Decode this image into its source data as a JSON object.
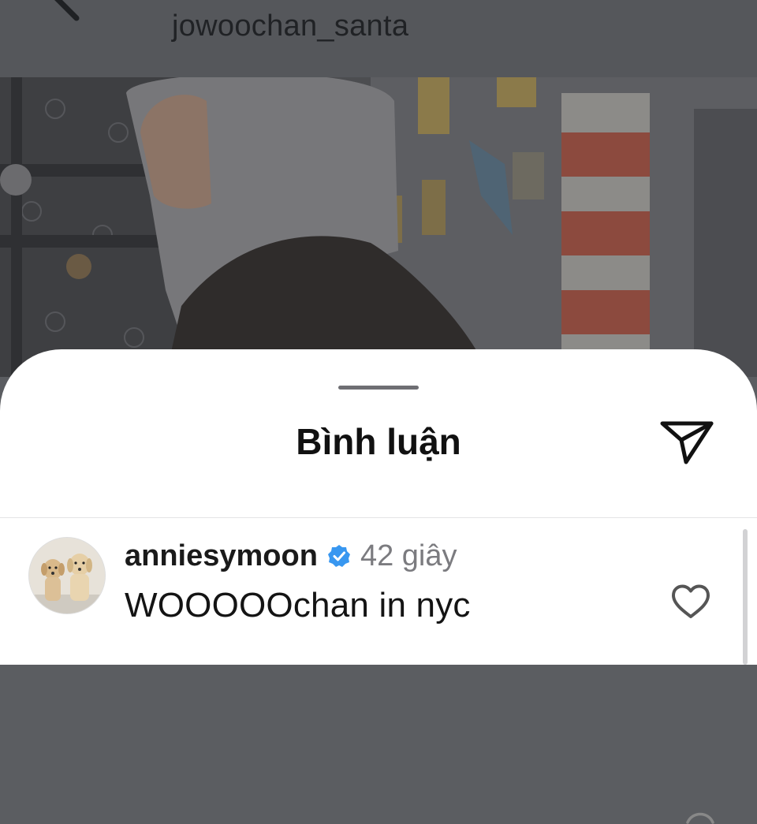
{
  "header": {
    "username": "jowoochan_santa",
    "back_icon": "chevron-left-icon"
  },
  "post": {
    "photo_description_icon": "post-photo"
  },
  "sheet": {
    "title": "Bình luận",
    "share_icon": "paper-plane-icon"
  },
  "comments": [
    {
      "username": "anniesymoon",
      "verified": true,
      "time": "42 giây",
      "text": "WOOOOOchan in nyc",
      "avatar_icon": "avatar-dogs",
      "like_icon": "heart-icon"
    }
  ],
  "colors": {
    "overlay": "#55575b",
    "sheet_bg": "#ffffff",
    "verified_blue": "#3897f0",
    "time_gray": "#7b7b7f"
  }
}
